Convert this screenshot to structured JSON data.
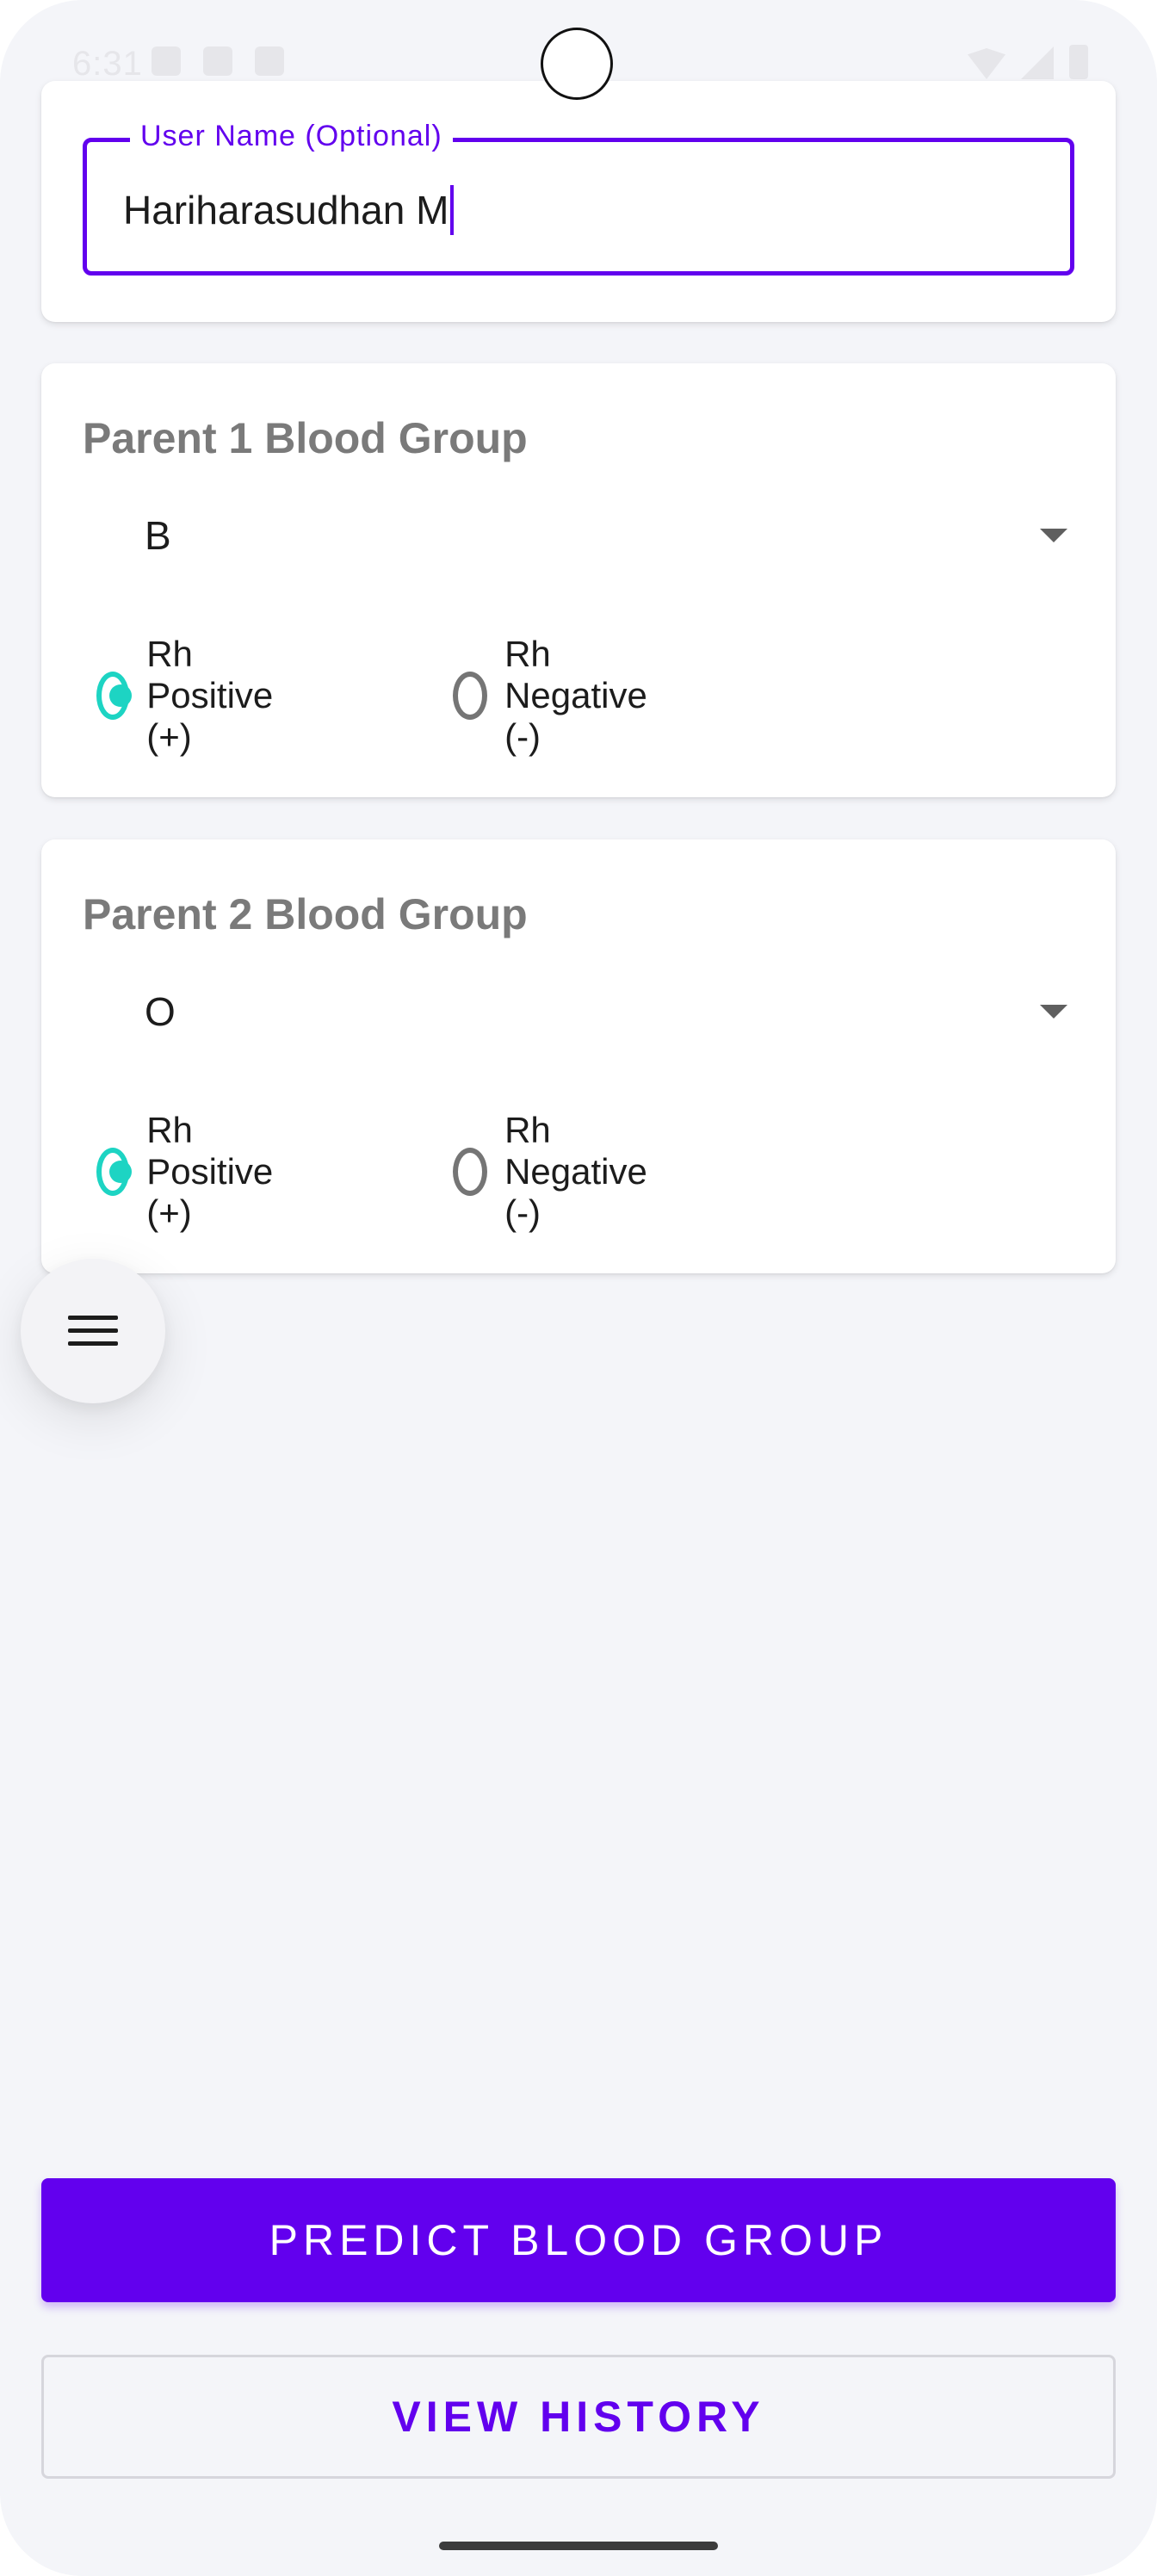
{
  "status_bar": {
    "time": "6:31",
    "left_icons": [
      "shield-icon",
      "font-icon",
      "sd-card-icon"
    ],
    "right_icons": [
      "wifi-icon",
      "signal-icon",
      "battery-icon"
    ]
  },
  "user_name": {
    "label": "User Name (Optional)",
    "value": "Hariharasudhan M"
  },
  "parent1": {
    "title": "Parent 1 Blood Group",
    "blood_group": "B",
    "rh_positive_label": "Rh Positive (+)",
    "rh_negative_label": "Rh Negative (-)",
    "selected_rh": "positive"
  },
  "parent2": {
    "title": "Parent 2 Blood Group",
    "blood_group": "O",
    "rh_positive_label": "Rh Positive (+)",
    "rh_negative_label": "Rh Negative (-)",
    "selected_rh": "positive"
  },
  "fab": {
    "icon": "menu-icon"
  },
  "buttons": {
    "predict_label": "PREDICT BLOOD GROUP",
    "history_label": "VIEW HISTORY"
  },
  "colors": {
    "primary": "#6200ee",
    "radio_checked": "#1dd4c3",
    "background": "#f4f5f9"
  }
}
